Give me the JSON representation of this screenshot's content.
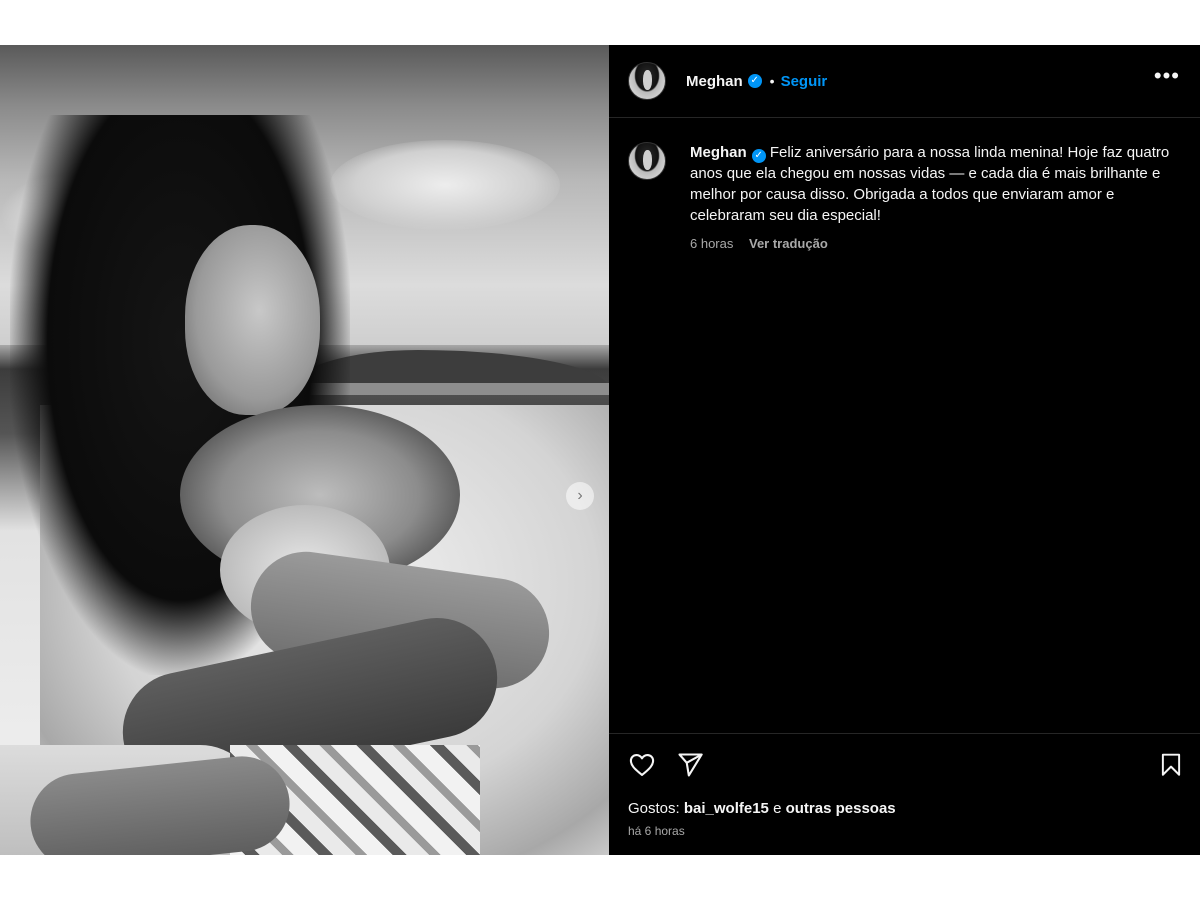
{
  "header": {
    "username": "Meghan",
    "separator": "•",
    "follow_label": "Seguir",
    "more_icon": "more-horizontal-icon"
  },
  "caption": {
    "username": "Meghan",
    "text": "Feliz aniversário para a nossa linda menina! Hoje faz quatro anos que ela chegou em nossas vidas — e cada dia é mais brilhante e melhor por causa disso. Obrigada a todos que enviaram amor e celebraram seu dia especial!",
    "time": "6 horas",
    "translation_label": "Ver tradução"
  },
  "actions": {
    "like_icon": "heart-icon",
    "share_icon": "paper-plane-icon",
    "save_icon": "bookmark-icon"
  },
  "likes": {
    "prefix": "Gostos:",
    "user": "bai_wolfe15",
    "connector": "e",
    "others": "outras pessoas"
  },
  "post_time": "há 6 horas",
  "colors": {
    "accent": "#0095f6",
    "panel_background": "#000000",
    "secondary_text": "#a8a8a8"
  }
}
